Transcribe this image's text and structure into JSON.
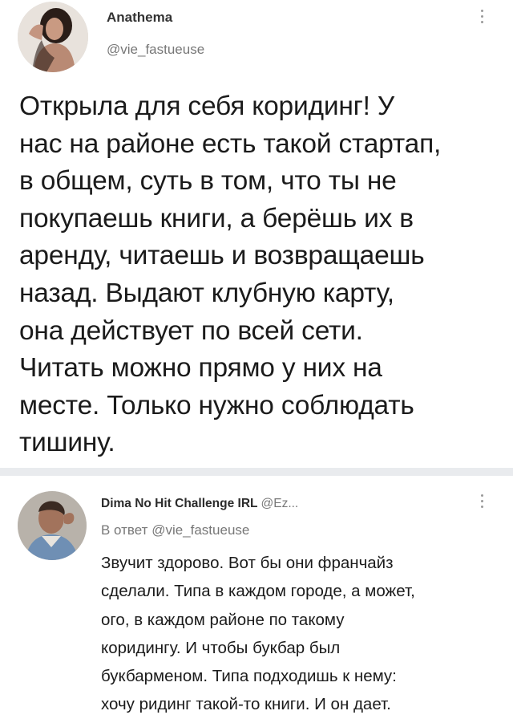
{
  "tweet": {
    "author_name": "Anathema",
    "author_handle": "@vie_fastueuse",
    "more_icon": "vertical-dots-icon",
    "text": "Открыла для себя коридинг! У\nнас на районе есть такой стартап,\nв общем, суть в том, что ты не\nпокупаешь книги, а берёшь их в\nаренду, читаешь и возвращаешь\nназад. Выдают клубную карту,\nона действует по всей сети.\nЧитать можно прямо у них на\nместе. Только нужно соблюдать\nтишину."
  },
  "reply": {
    "author_name": "Dima No Hit Challenge IRL",
    "author_handle": "@Ez...",
    "reply_to_prefix": "В ответ",
    "reply_to_handle": "@vie_fastueuse",
    "more_icon": "vertical-dots-icon",
    "text": "Звучит здорово. Вот бы они франчайз\nсделали. Типа в каждом городе, а может,\nого, в каждом районе по такому\nкоридингу. И чтобы букбар был\nбукбарменом. Типа подходишь к нему:\nхочу ридинг такой-то книги. И он дает."
  },
  "colors": {
    "text": "#1b1b1b",
    "muted": "#777777",
    "separator": "#e9ebee"
  }
}
